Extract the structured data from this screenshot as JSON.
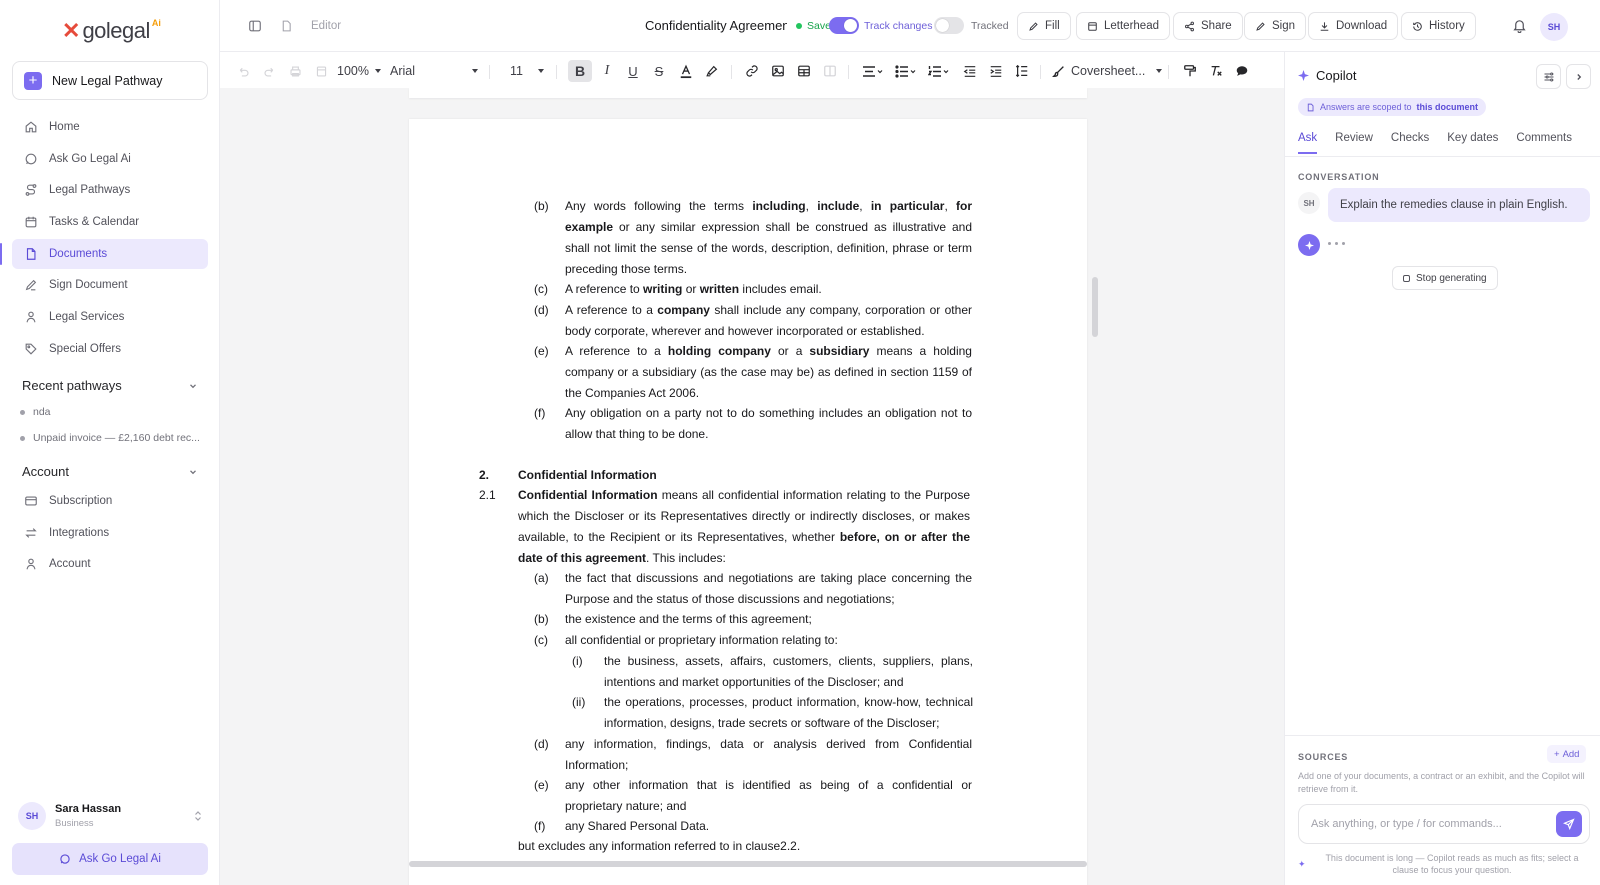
{
  "brand": {
    "logo_x": "✕",
    "logo_text": "golegal",
    "logo_ai": "Ai"
  },
  "sidebar": {
    "new_button": "New Legal Pathway",
    "nav": [
      {
        "label": "Home",
        "icon": "home-icon"
      },
      {
        "label": "Ask Go Legal Ai",
        "icon": "chat-icon"
      },
      {
        "label": "Legal Pathways",
        "icon": "route-icon"
      },
      {
        "label": "Tasks & Calendar",
        "icon": "calendar-icon"
      },
      {
        "label": "Documents",
        "icon": "document-icon",
        "active": true
      },
      {
        "label": "Sign Document",
        "icon": "pen-icon"
      },
      {
        "label": "Legal Services",
        "icon": "person-icon"
      },
      {
        "label": "Special Offers",
        "icon": "tag-icon"
      }
    ],
    "recent_heading": "Recent pathways",
    "recent": [
      "nda",
      "Unpaid invoice — £2,160 debt rec..."
    ],
    "account_heading": "Account",
    "account_items": [
      {
        "label": "Subscription",
        "icon": "card-icon"
      },
      {
        "label": "Integrations",
        "icon": "swap-icon"
      },
      {
        "label": "Account",
        "icon": "person-icon"
      }
    ],
    "user": {
      "initials": "SH",
      "name": "Sara Hassan",
      "plan": "Business"
    },
    "ask_button": "Ask Go Legal Ai"
  },
  "topbar": {
    "editor_label": "Editor",
    "doc_title": "Confidentiality Agreemen",
    "saved": "Saved",
    "track_changes": "Track changes",
    "tracked": "Tracked",
    "buttons": {
      "fill": "Fill",
      "letterhead": "Letterhead",
      "share": "Share",
      "sign": "Sign",
      "download": "Download",
      "history": "History"
    },
    "avatar": "SH"
  },
  "format": {
    "zoom": "100%",
    "font": "Arial",
    "size": "11",
    "style": "Coversheet..."
  },
  "document": {
    "b_top": {
      "label": "(b)",
      "pre": "Any words following the terms ",
      "t1": "including",
      "s1": ", ",
      "t2": "include",
      "s2": ", ",
      "t3": "in particular",
      "s3": ", ",
      "t4": "for example",
      "post": " or any similar expression shall be construed as illustrative and shall not limit the sense of the words, description, definition, phrase or term preceding those terms."
    },
    "c_top": {
      "label": "(c)",
      "pre": "A reference to ",
      "t1": "writing",
      "mid": " or ",
      "t2": "written",
      "post": " includes email."
    },
    "d_top": {
      "label": "(d)",
      "pre": "A reference to a ",
      "t1": "company",
      "post": " shall include any company, corporation or other body corporate, wherever and however incorporated or established."
    },
    "e_top": {
      "label": "(e)",
      "pre": "A reference to a ",
      "t1": "holding company",
      "mid": " or a ",
      "t2": "subsidiary",
      "post": " means a holding company or a subsidiary (as the case may be) as defined in section 1159 of the Companies Act 2006."
    },
    "f_top": {
      "label": "(f)",
      "text": "Any obligation on a party not to do something includes an obligation not to allow that thing to be done."
    },
    "section2": {
      "num": "2.",
      "title": "Confidential Information"
    },
    "c21": {
      "num": "2.1",
      "t1": "Confidential Information",
      "pre": " means all confidential information relating to the Purpose which the Discloser or its Representatives directly or indirectly discloses, or makes available, to the Recipient or its Representatives, whether ",
      "t2": "before, on or after the date of this agreement",
      "post": ". This includes:"
    },
    "a2": {
      "label": "(a)",
      "text": "the fact that discussions and negotiations are taking place concerning the Purpose and the status of those discussions and negotiations;"
    },
    "b2": {
      "label": "(b)",
      "text": "the existence and the terms of this agreement;"
    },
    "c2": {
      "label": "(c)",
      "text": "all confidential or proprietary information relating to:"
    },
    "i2": {
      "label": "(i)",
      "text": "the business, assets, affairs, customers, clients, suppliers, plans, intentions and market opportunities of the Discloser; and"
    },
    "ii2": {
      "label": "(ii)",
      "text": "the operations, processes, product information, know-how, technical information, designs, trade secrets or software of the Discloser;"
    },
    "d2": {
      "label": "(d)",
      "text": "any information, findings, data or analysis derived from Confidential Information;"
    },
    "e2": {
      "label": "(e)",
      "text": "any other information that is identified as being of a confidential or proprietary nature; and"
    },
    "f2": {
      "label": "(f)",
      "text": "any Shared Personal Data."
    },
    "excl": "but excludes any information referred to in clause2.2."
  },
  "copilot": {
    "title": "Copilot",
    "scope_pre": "Answers are scoped to",
    "scope_b": "this document",
    "tabs": [
      "Ask",
      "Review",
      "Checks",
      "Key dates",
      "Comments"
    ],
    "conversation_label": "CONVERSATION",
    "user_initials": "SH",
    "user_message": "Explain the remedies clause in plain English.",
    "stop_button": "Stop generating",
    "sources_label": "SOURCES",
    "add_button": "Add",
    "sources_help": "Add one of your documents, a contract or an exhibit, and the Copilot will retrieve from it.",
    "input_placeholder": "Ask anything, or type / for commands...",
    "footer_note": "This document is long — Copilot reads as much as fits; select a clause to focus your question."
  },
  "colors": {
    "accent": "#7c6cf0",
    "accent_bg": "#ece9fd",
    "saved_green": "#22c55e"
  }
}
